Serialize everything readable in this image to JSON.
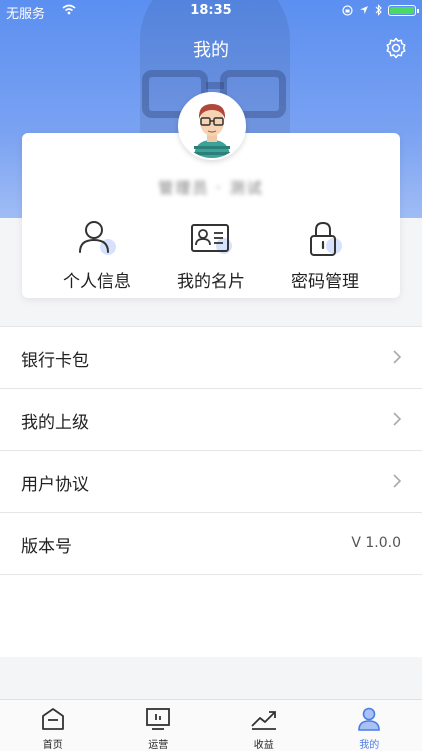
{
  "status_bar": {
    "carrier": "无服务",
    "time": "18:35"
  },
  "header": {
    "title": "我的"
  },
  "profile": {
    "username": "管理员 · 测试"
  },
  "quick_actions": [
    {
      "label": "个人信息",
      "icon": "person-icon"
    },
    {
      "label": "我的名片",
      "icon": "card-icon"
    },
    {
      "label": "密码管理",
      "icon": "lock-icon"
    }
  ],
  "menu": [
    {
      "label": "银行卡包"
    },
    {
      "label": "我的上级"
    },
    {
      "label": "用户协议"
    },
    {
      "label": "版本号",
      "value": "V 1.0.0"
    }
  ],
  "tabbar": [
    {
      "label": "首页",
      "icon": "home-icon"
    },
    {
      "label": "运营",
      "icon": "monitor-icon"
    },
    {
      "label": "收益",
      "icon": "trend-icon"
    },
    {
      "label": "我的",
      "icon": "profile-icon",
      "active": true
    }
  ],
  "colors": {
    "accent": "#4a7de8",
    "header": "#6b98f0"
  }
}
